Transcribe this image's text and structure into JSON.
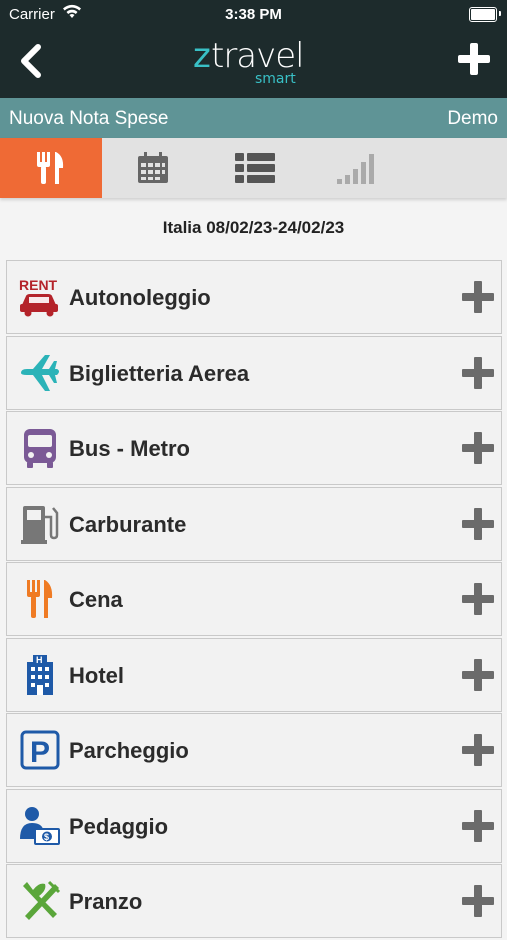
{
  "status_bar": {
    "carrier": "Carrier",
    "time": "3:38 PM"
  },
  "navbar": {
    "logo_z": "z",
    "logo_travel": "travel",
    "logo_smart": "smart"
  },
  "subbar": {
    "title": "Nuova Nota Spese",
    "user": "Demo"
  },
  "tabs": [
    {
      "icon": "fork-knife-icon",
      "active": true
    },
    {
      "icon": "calendar-icon",
      "active": false
    },
    {
      "icon": "list-icon",
      "active": false
    },
    {
      "icon": "signal-bars-icon",
      "active": false
    }
  ],
  "trip": {
    "date_range": "Italia 08/02/23-24/02/23"
  },
  "categories": [
    {
      "label": "Autonoleggio",
      "icon": "rent-car-icon",
      "icon_text": "RENT",
      "color": "#b4232a"
    },
    {
      "label": "Biglietteria Aerea",
      "icon": "airplane-icon",
      "color": "#2bb3b8"
    },
    {
      "label": "Bus - Metro",
      "icon": "bus-icon",
      "color": "#7b5a96"
    },
    {
      "label": "Carburante",
      "icon": "fuel-pump-icon",
      "color": "#777777"
    },
    {
      "label": "Cena",
      "icon": "fork-knife-icon",
      "color": "#ef7b24"
    },
    {
      "label": "Hotel",
      "icon": "hotel-icon",
      "icon_text": "H",
      "color": "#1f5aa8"
    },
    {
      "label": "Parcheggio",
      "icon": "parking-icon",
      "icon_text": "P",
      "color": "#1f5aa8"
    },
    {
      "label": "Pedaggio",
      "icon": "toll-icon",
      "icon_text": "$",
      "color": "#1f5aa8"
    },
    {
      "label": "Pranzo",
      "icon": "fork-knife-crossed-icon",
      "color": "#5aa63a"
    }
  ],
  "colors": {
    "nav_bg": "#1d2b2c",
    "subbar_bg": "#5f9496",
    "tab_active": "#ef6a35",
    "accent": "#39c0c6"
  }
}
